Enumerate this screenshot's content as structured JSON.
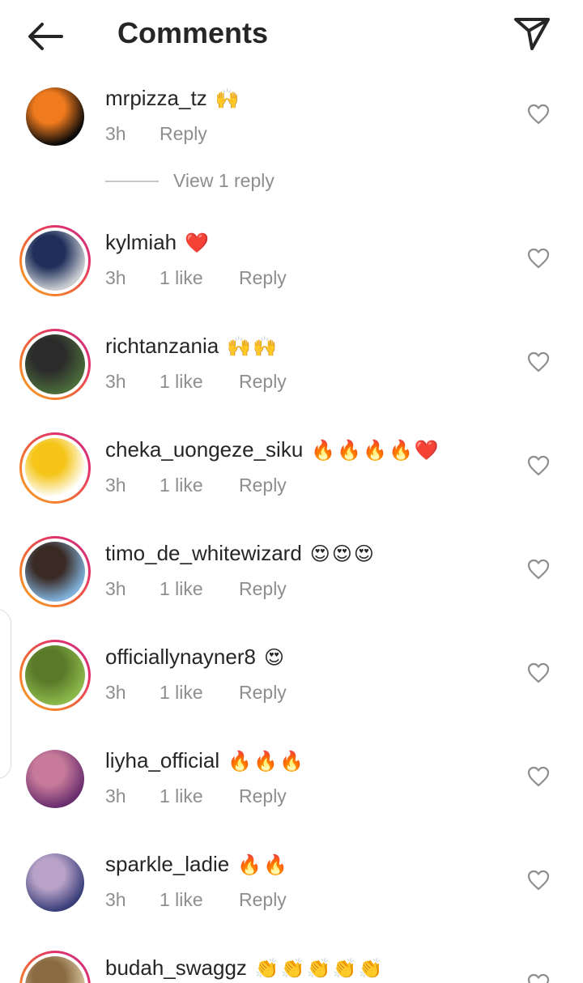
{
  "header": {
    "title": "Comments",
    "back_icon": "arrow-left-icon",
    "send_icon": "paper-plane-icon"
  },
  "comments": [
    {
      "username": "mrpizza_tz",
      "emojis": "🙌",
      "time": "3h",
      "likes": "",
      "reply": "Reply",
      "avatar_style": "plain",
      "avatar_colors": [
        "#0a0a0a",
        "#f07b1e"
      ],
      "view_replies": "View 1 reply"
    },
    {
      "username": "kylmiah",
      "emojis": "❤️",
      "time": "3h",
      "likes": "1 like",
      "reply": "Reply",
      "avatar_style": "ring",
      "avatar_colors": [
        "#c9cdd2",
        "#1f2f5a"
      ]
    },
    {
      "username": "richtanzania",
      "emojis": "🙌🙌",
      "time": "3h",
      "likes": "1 like",
      "reply": "Reply",
      "avatar_style": "ring",
      "avatar_colors": [
        "#4a6b3a",
        "#2b2b2b"
      ]
    },
    {
      "username": "cheka_uongeze_siku",
      "emojis": "🔥🔥🔥🔥❤️",
      "time": "3h",
      "likes": "1 like",
      "reply": "Reply",
      "avatar_style": "ring",
      "avatar_colors": [
        "#ffffff",
        "#f5c518"
      ]
    },
    {
      "username": "timo_de_whitewizard",
      "emojis": "😍😍😍",
      "time": "3h",
      "likes": "1 like",
      "reply": "Reply",
      "avatar_style": "ring",
      "avatar_colors": [
        "#7fb0d9",
        "#3a2a24"
      ]
    },
    {
      "username": "officiallynayner8",
      "emojis": "😍",
      "time": "3h",
      "likes": "1 like",
      "reply": "Reply",
      "avatar_style": "ring",
      "avatar_colors": [
        "#8bb84a",
        "#5a7a2a"
      ]
    },
    {
      "username": "liyha_official",
      "emojis": "🔥🔥🔥",
      "time": "3h",
      "likes": "1 like",
      "reply": "Reply",
      "avatar_style": "plain",
      "avatar_colors": [
        "#6a2f6e",
        "#c77a9a"
      ]
    },
    {
      "username": "sparkle_ladie",
      "emojis": "🔥🔥",
      "time": "3h",
      "likes": "1 like",
      "reply": "Reply",
      "avatar_style": "plain",
      "avatar_colors": [
        "#3a3f7a",
        "#b8a2c8"
      ]
    },
    {
      "username": "budah_swaggz",
      "emojis": "👏👏👏👏👏",
      "time": "",
      "likes": "",
      "reply": "",
      "avatar_style": "ring",
      "avatar_colors": [
        "#d9c8a4",
        "#8a6a40"
      ]
    }
  ]
}
